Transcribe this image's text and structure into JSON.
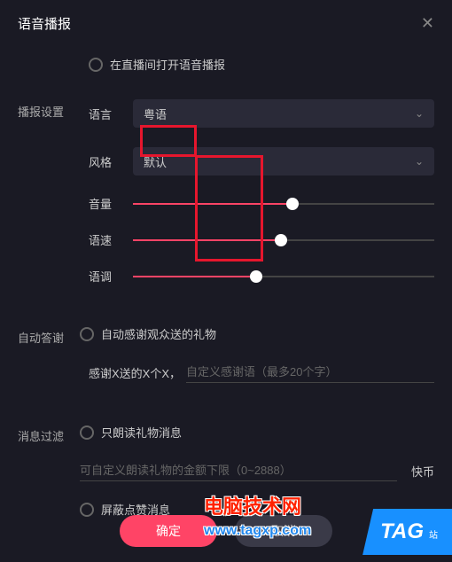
{
  "header": {
    "title": "语音播报"
  },
  "live": {
    "open_label": "在直播间打开语音播报"
  },
  "settings": {
    "section_label": "播报设置",
    "language_label": "语言",
    "language_value": "粤语",
    "style_label": "风格",
    "style_value": "默认",
    "volume_label": "音量",
    "volume_percent": 53,
    "speed_label": "语速",
    "speed_percent": 49,
    "tone_label": "语调",
    "tone_percent": 41
  },
  "thanks": {
    "section_label": "自动答谢",
    "auto_label": "自动感谢观众送的礼物",
    "prefix_text": "感谢X送的X个X，",
    "placeholder": "自定义感谢语（最多20个字）"
  },
  "filter": {
    "section_label": "消息过滤",
    "gift_only_label": "只朗读礼物消息",
    "amount_placeholder": "可自定义朗读礼物的金额下限（0~2888）",
    "currency_suffix": "快币",
    "block_like_label": "屏蔽点赞消息"
  },
  "footer": {
    "confirm_label": "确定",
    "cancel_label": "取消"
  },
  "watermark": {
    "line1": "电脑技术网",
    "line2": "www.tagxp.com",
    "tag": "TAG",
    "tag_sub": "站"
  }
}
